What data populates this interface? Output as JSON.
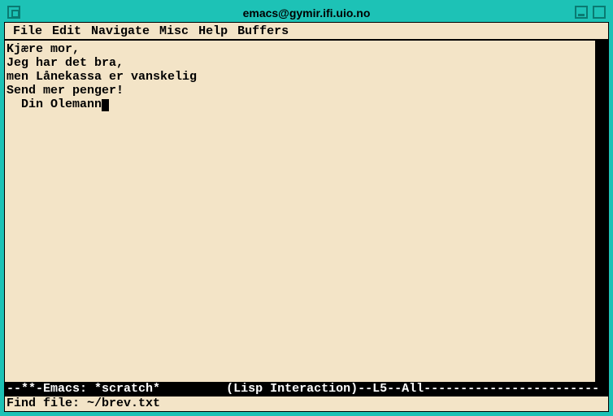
{
  "window": {
    "title": "emacs@gymir.ifi.uio.no"
  },
  "menubar": {
    "items": [
      "File",
      "Edit",
      "Navigate",
      "Misc",
      "Help",
      "Buffers"
    ]
  },
  "buffer": {
    "lines": [
      "Kjære mor,",
      "Jeg har det bra,",
      "men Lånekassa er vanskelig",
      "Send mer penger!",
      "  Din Olemann"
    ],
    "cursor_on_last_line": true
  },
  "modeline": {
    "prefix": "--**-",
    "app": "Emacs: ",
    "buffer_name": "*scratch*",
    "mode": "(Lisp Interaction)",
    "position": "--L5--All",
    "trail_dashes": "------------------------"
  },
  "minibuffer": {
    "prompt": "Find file: ",
    "input": "~/brev.txt"
  }
}
